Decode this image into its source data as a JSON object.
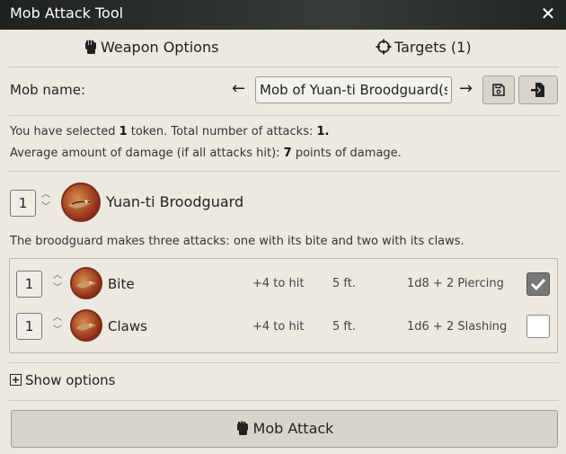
{
  "window": {
    "title": "Mob Attack Tool",
    "close_label": "✕"
  },
  "tabs": [
    {
      "label": "Weapon Options",
      "icon": "fist-icon",
      "active": true
    },
    {
      "label": "Targets (1)",
      "icon": "crosshair-icon",
      "active": false
    }
  ],
  "mob": {
    "label": "Mob name:",
    "prev_arrow": "←",
    "next_arrow": "→",
    "name_value": "Mob of Yuan-ti Broodguard(s)",
    "save_icon": "save-icon",
    "load_icon": "file-import-icon"
  },
  "summary": {
    "line1_pre": "You have selected ",
    "token_count": "1",
    "line1_mid": " token. Total number of attacks: ",
    "attack_count": "1.",
    "line2_pre": "Average amount of damage (if all attacks hit): ",
    "damage": "7",
    "line2_post": " points of damage."
  },
  "monster": {
    "quantity": "1",
    "name": "Yuan-ti Broodguard",
    "description": "The broodguard makes three attacks: one with its bite and two with its claws."
  },
  "attacks": [
    {
      "quantity": "1",
      "name": "Bite",
      "to_hit": "+4 to hit",
      "reach": "5 ft.",
      "damage": "1d8 + 2 Piercing",
      "checked": true
    },
    {
      "quantity": "1",
      "name": "Claws",
      "to_hit": "+4 to hit",
      "reach": "5 ft.",
      "damage": "1d6 + 2 Slashing",
      "checked": false
    }
  ],
  "options": {
    "show_label": "Show options"
  },
  "action": {
    "label": "Mob Attack"
  },
  "colors": {
    "titlebar": "#2e3432",
    "panel": "#ece9e1",
    "button": "#d7d4ca",
    "avatar_red": "#8f2b17"
  }
}
